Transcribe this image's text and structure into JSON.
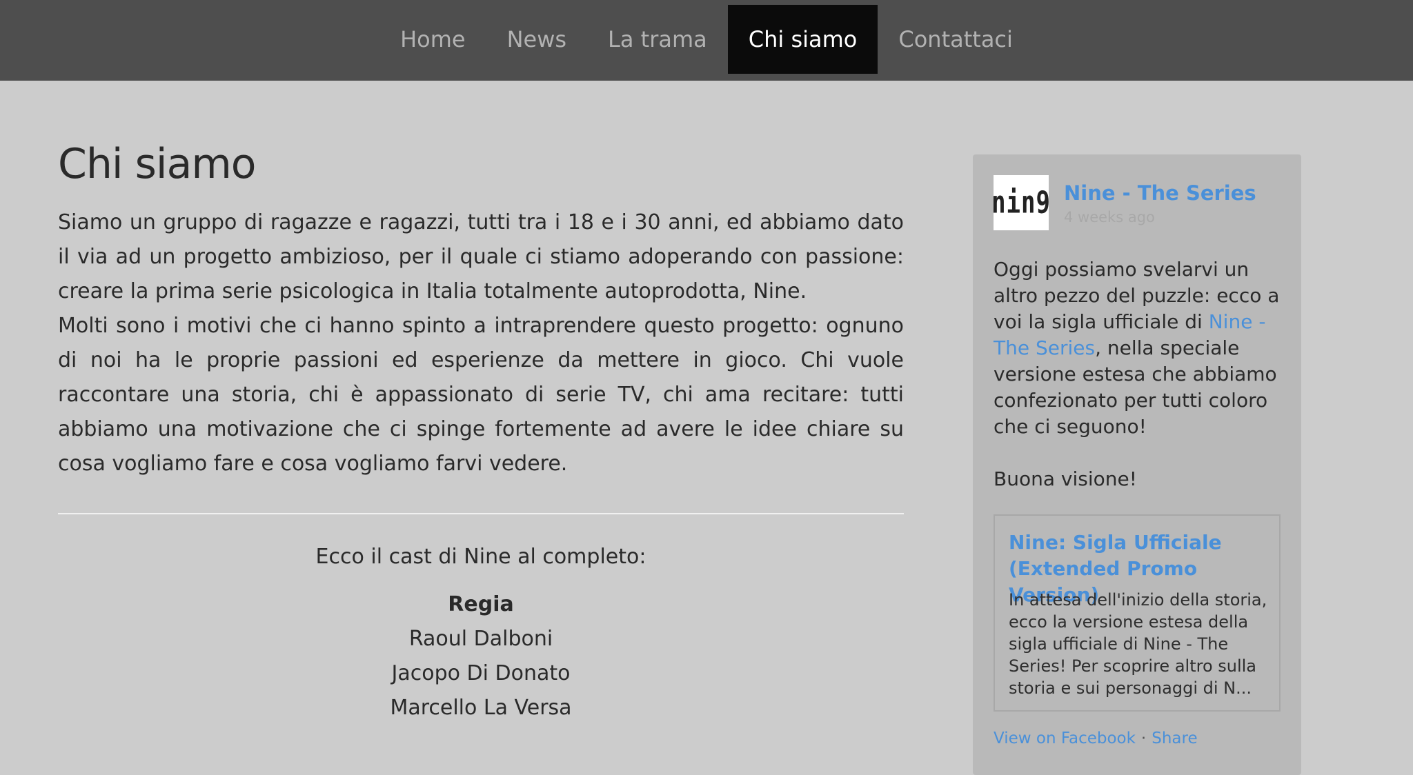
{
  "nav": {
    "items": [
      {
        "label": "Home",
        "active": false
      },
      {
        "label": "News",
        "active": false
      },
      {
        "label": "La trama",
        "active": false
      },
      {
        "label": "Chi siamo",
        "active": true
      },
      {
        "label": "Contattaci",
        "active": false
      }
    ]
  },
  "main": {
    "title": "Chi siamo",
    "paragraphs": [
      "Siamo un gruppo di ragazze e ragazzi, tutti tra i 18 e i 30 anni, ed abbiamo dato il via ad un progetto ambizioso, per il quale ci stiamo adoperando con passione: creare la prima serie psicologica in Italia totalmente autoprodotta, Nine.",
      "Molti sono i motivi che ci hanno spinto a intraprendere questo progetto: ognuno di noi ha le proprie passioni ed esperienze da mettere in gioco. Chi vuole raccontare una storia, chi è appassionato di serie TV, chi ama recitare: tutti abbiamo una motivazione che ci spinge fortemente ad avere le idee chiare su cosa vogliamo fare e cosa vogliamo farvi vedere."
    ],
    "cast_intro": "Ecco il cast di Nine al completo:",
    "cast": {
      "heading": "Regia",
      "members": [
        "Raoul Dalboni",
        "Jacopo Di Donato",
        "Marcello La Versa"
      ]
    }
  },
  "facebook": {
    "logo_text": "nin9",
    "page_name": "Nine - The Series",
    "time_ago": "4 weeks ago",
    "post": {
      "text_before_link": "Oggi possiamo svelarvi un altro pezzo del puzzle: ecco a voi la sigla ufficiale di ",
      "link_text": "Nine - The Series",
      "text_after_link": ", nella speciale versione estesa che abbiamo confezionato per tutti coloro che ci seguono!",
      "closing": "Buona visione!"
    },
    "card": {
      "title": "Nine: Sigla Ufficiale (Extended Promo Version)",
      "description": "In attesa dell'inizio della storia, ecco la versione estesa della sigla ufficiale di Nine - The Series! Per scoprire altro sulla storia e sui personaggi di N..."
    },
    "footer": {
      "view_label": "View on Facebook",
      "separator": "·",
      "share_label": "Share"
    }
  },
  "colors": {
    "nav_background": "#4e4e4e",
    "nav_active": "#0b0b0b",
    "page_background": "#cccccc",
    "widget_background": "#b9b9b9",
    "link": "#4a90d9"
  }
}
